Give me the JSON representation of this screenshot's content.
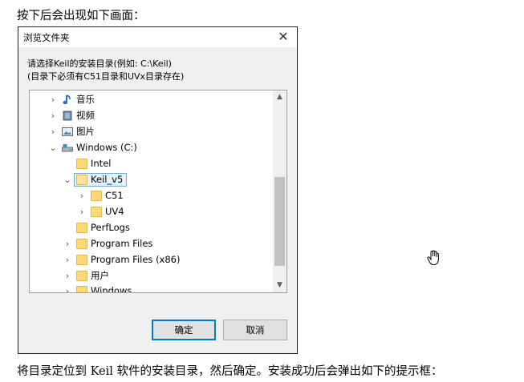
{
  "document": {
    "intro_text": "按下后会出现如下画面：",
    "outro_text": "将目录定位到 Keil 软件的安装目录，然后确定。安装成功后会弹出如下的提示框："
  },
  "dialog": {
    "title": "浏览文件夹",
    "close_glyph": "✕",
    "instruction_line1": "请选择Keil的安装目录(例如: C:\\Keil)",
    "instruction_line2": "(目录下必须有C51目录和UVx目录存在)",
    "tree_items": [
      {
        "label": "音乐",
        "chevron": "›",
        "icon": "music-icon"
      },
      {
        "label": "视频",
        "chevron": "›",
        "icon": "video-icon"
      },
      {
        "label": "图片",
        "chevron": "›",
        "icon": "picture-icon"
      },
      {
        "label": "Windows (C:)",
        "chevron": "⌄",
        "icon": "drive-icon"
      },
      {
        "label": "Intel",
        "chevron": "",
        "icon": "folder-icon"
      },
      {
        "label": "Keil_v5",
        "chevron": "⌄",
        "icon": "folder-icon",
        "selected": true
      },
      {
        "label": "C51",
        "chevron": "›",
        "icon": "folder-icon"
      },
      {
        "label": "UV4",
        "chevron": "›",
        "icon": "folder-icon"
      },
      {
        "label": "PerfLogs",
        "chevron": "",
        "icon": "folder-icon"
      },
      {
        "label": "Program Files",
        "chevron": "›",
        "icon": "folder-icon"
      },
      {
        "label": "Program Files (x86)",
        "chevron": "›",
        "icon": "folder-icon"
      },
      {
        "label": "用户",
        "chevron": "›",
        "icon": "folder-icon"
      },
      {
        "label": "Windows",
        "chevron": "›",
        "icon": "folder-icon"
      }
    ],
    "scroll_up_glyph": "▲",
    "scroll_down_glyph": "▼",
    "ok_label": "确定",
    "cancel_label": "取消"
  },
  "colors": {
    "folder": "#fcd977",
    "selection_bg": "#e5f1fb",
    "selection_border": "#7aa7d8",
    "default_button_border": "#0078d7"
  }
}
